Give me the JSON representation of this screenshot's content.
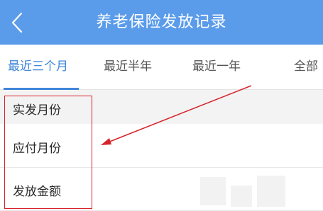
{
  "header": {
    "title": "养老保险发放记录"
  },
  "tabs": [
    {
      "label": "最近三个月",
      "active": true
    },
    {
      "label": "最近半年",
      "active": false
    },
    {
      "label": "最近一年",
      "active": false
    },
    {
      "label": "全部",
      "active": false
    }
  ],
  "section": {
    "label": "实发月份"
  },
  "rows": [
    {
      "label": "应付月份"
    },
    {
      "label": "发放金额"
    }
  ],
  "colors": {
    "header_bg": "#5b9cea",
    "active_tab": "#3f86d9",
    "annotation_red": "#d6232a"
  },
  "icons": {
    "back": "chevron-left-icon"
  }
}
